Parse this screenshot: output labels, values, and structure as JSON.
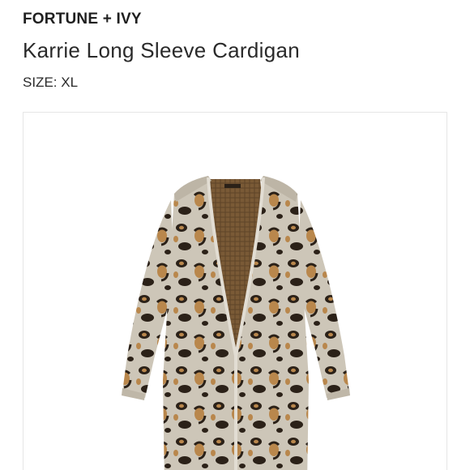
{
  "product": {
    "brand": "FORTUNE + IVY",
    "title": "Karrie Long Sleeve Cardigan",
    "size": "SIZE: XL"
  },
  "image": {
    "subject": "leopard-print-cardigan-icon",
    "colors": {
      "base": "#cfc8bb",
      "spot_dark": "#2b2118",
      "spot_tan": "#b9874c",
      "inner": "#7a5a36"
    }
  }
}
